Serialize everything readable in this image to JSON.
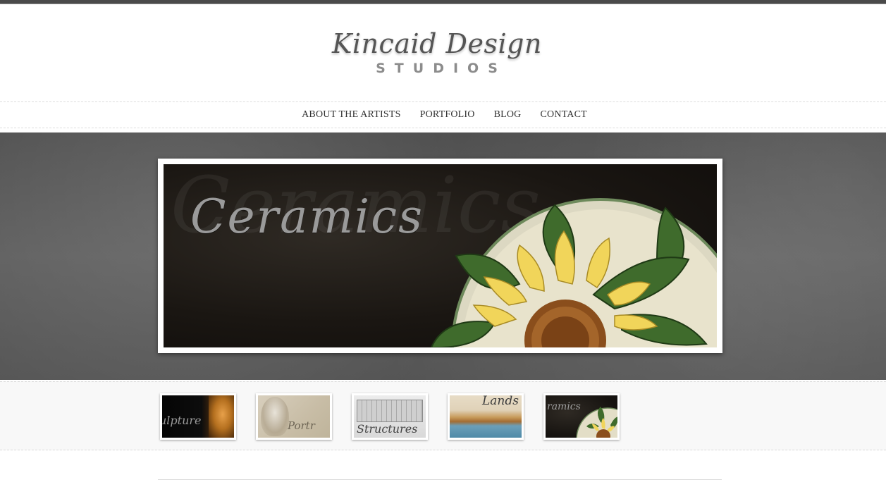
{
  "logo": {
    "script_text": "Kincaid Design",
    "sub_text": "STUDIOS"
  },
  "nav": {
    "items": [
      {
        "label": "ABOUT THE ARTISTS"
      },
      {
        "label": "PORTFOLIO"
      },
      {
        "label": "BLOG"
      },
      {
        "label": "CONTACT"
      }
    ]
  },
  "hero": {
    "title": "Ceramics"
  },
  "thumbnails": [
    {
      "label": "ulpture"
    },
    {
      "label": "Portr"
    },
    {
      "label": "Structures"
    },
    {
      "label": "Lands"
    },
    {
      "label": "ramics"
    }
  ],
  "colors": {
    "topbar": "#4a4a4a",
    "hero_background": "#555555",
    "nav_text": "#333333"
  }
}
